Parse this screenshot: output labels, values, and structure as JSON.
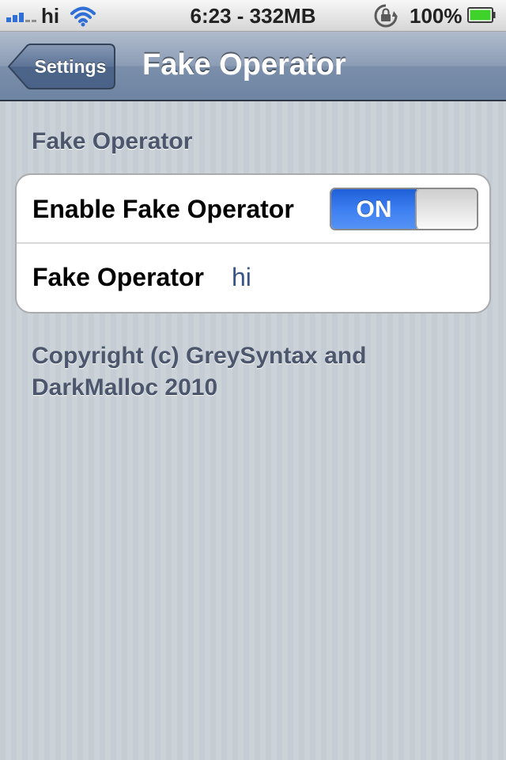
{
  "status_bar": {
    "carrier": "hi",
    "time": "6:23 - 332MB",
    "battery_percent": "100%",
    "signal_bars": 5,
    "signal_bars_active": 3,
    "battery_level": 1.0,
    "icons": [
      "signal-icon",
      "wifi-icon",
      "orientation-lock-icon",
      "battery-icon"
    ]
  },
  "navbar": {
    "back_label": "Settings",
    "title": "Fake Operator"
  },
  "section": {
    "header": "Fake Operator"
  },
  "rows": [
    {
      "label": "Enable Fake Operator",
      "toggle_label": "ON",
      "toggle_state": true
    },
    {
      "label": "Fake Operator",
      "value": "hi"
    }
  ],
  "footer": {
    "line1": "Copyright (c) GreySyntax and",
    "line2": "DarkMalloc 2010"
  },
  "colors": {
    "accent_blue": "#2f6fd6",
    "value_text": "#385487",
    "group_header": "#4c566c",
    "nav_bar": "#6d84a2",
    "battery_green": "#3fd22b"
  }
}
